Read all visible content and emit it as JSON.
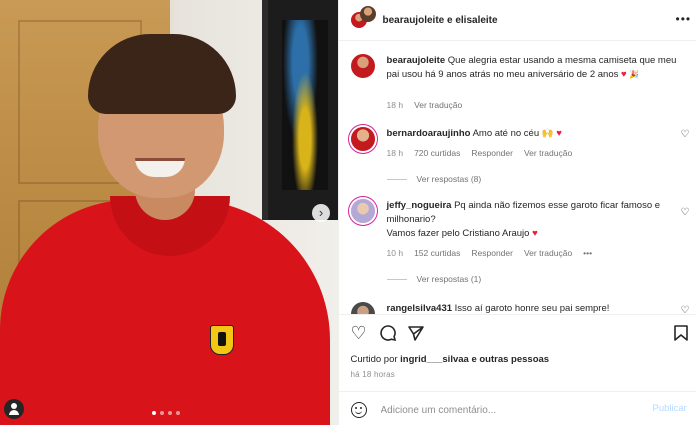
{
  "photo": {
    "next_glyph": "›",
    "carousel_index": 1,
    "carousel_count": 4,
    "tag_icon": "user-tag-icon"
  },
  "header": {
    "title": "bearaujoleite e elisaleite",
    "more": "•••"
  },
  "caption": {
    "username": "bearaujoleite",
    "text": "Que alegria estar usando a mesma camiseta que meu pai usou há 9 anos atrás no meu aniversário de 2 anos",
    "emoji_heart": "♥",
    "emoji_extra": "🎉",
    "time": "18 h",
    "translate": "Ver tradução"
  },
  "comments": [
    {
      "username": "bernardoaraujinho",
      "text": "Amo até no céu",
      "emoji": "🙌 ♥",
      "time": "18 h",
      "likes": "720 curtidas",
      "reply": "Responder",
      "translate": "Ver tradução",
      "replies": "Ver respostas (8)"
    },
    {
      "username": "jeffy_nogueira",
      "text": "Pq ainda não fizemos esse garoto ficar famoso e milhonario?",
      "text2": "Vamos fazer pelo Cristiano Araujo",
      "emoji": "♥",
      "time": "10 h",
      "likes": "152 curtidas",
      "reply": "Responder",
      "translate": "Ver tradução",
      "more": "•••",
      "replies": "Ver respostas (1)"
    },
    {
      "username": "rangelsilva431",
      "text": "Isso aí garoto honre seu pai sempre!"
    }
  ],
  "actions": {
    "like_icon": "heart-icon",
    "comment_icon": "comment-icon",
    "share_icon": "share-icon",
    "save_icon": "bookmark-icon"
  },
  "likes": {
    "prefix": "Curtido por",
    "user": "ingrid___silvaa",
    "suffix": "e outras pessoas",
    "ago": "há 18 horas"
  },
  "comment_input": {
    "placeholder": "Adicione um comentário...",
    "post_label": "Publicar"
  },
  "colors": {
    "accent_blue": "#0095f6",
    "heart_red": "#ed1c3c",
    "muted": "#8e8e8e"
  }
}
